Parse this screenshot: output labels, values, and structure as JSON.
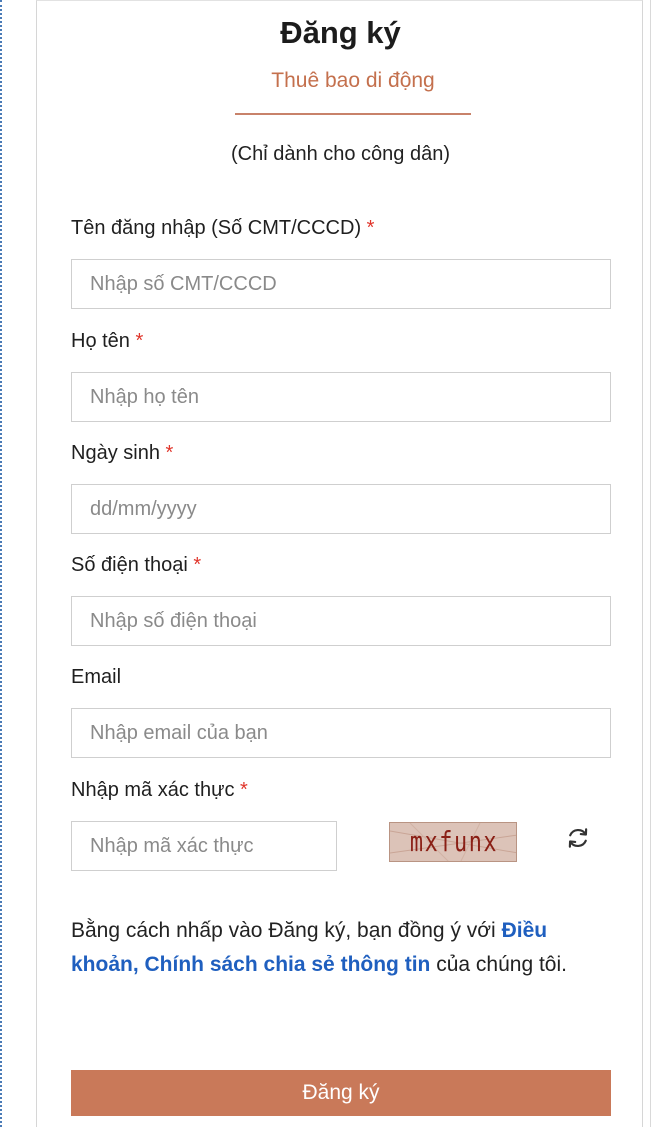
{
  "form": {
    "title": "Đăng ký",
    "tab_label": "Thuê bao di động",
    "subtitle": "(Chỉ dành cho công dân)",
    "fields": [
      {
        "label": "Tên đăng nhập (Số CMT/CCCD)",
        "required": "*",
        "placeholder": "Nhập số CMT/CCCD",
        "value": ""
      },
      {
        "label": "Họ tên",
        "required": "*",
        "placeholder": "Nhập họ tên",
        "value": ""
      },
      {
        "label": "Ngày sinh",
        "required": "*",
        "placeholder": "dd/mm/yyyy",
        "value": ""
      },
      {
        "label": "Số điện thoại",
        "required": "*",
        "placeholder": "Nhập số điện thoại",
        "value": ""
      },
      {
        "label": "Email",
        "required": "",
        "placeholder": "Nhập email của bạn",
        "value": ""
      }
    ],
    "captcha": {
      "label": "Nhập mã xác thực",
      "required": "*",
      "placeholder": "Nhập mã xác thực",
      "value": "",
      "image_text": "mxfunx",
      "refresh_icon": "refresh-icon"
    },
    "terms": {
      "prefix": "Bằng cách nhấp vào Đăng ký, bạn đồng ý với ",
      "link": "Điều khoản, Chính sách chia sẻ thông tin",
      "suffix": " của chúng tôi."
    },
    "submit_label": "Đăng ký"
  },
  "colors": {
    "accent": "#c97959",
    "tab_text": "#c4704d",
    "required": "#e0352b",
    "link": "#1f5fbf"
  }
}
